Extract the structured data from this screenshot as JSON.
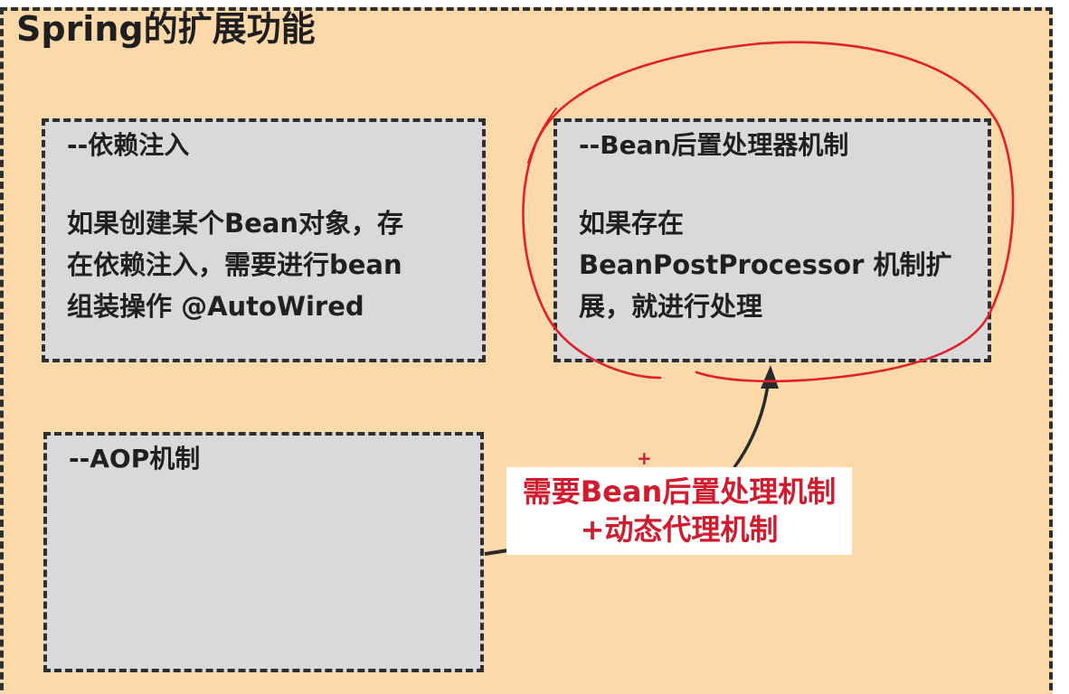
{
  "title": "Spring的扩展功能",
  "boxes": {
    "dependency_injection": {
      "title": "--依赖注入",
      "body_lines": [
        "如果创建某个Bean对象，存",
        "在依赖注入，需要进行bean",
        "组装操作 @AutoWired"
      ]
    },
    "bean_post_processor": {
      "title": "--Bean后置处理器机制",
      "body_lines": [
        "如果存在",
        "BeanPostProcessor 机制扩",
        "展，就进行处理"
      ]
    },
    "aop": {
      "title": "--AOP机制"
    }
  },
  "annotation": {
    "plus_mark": "+",
    "lines": [
      "需要Bean后置处理机制",
      "+动态代理机制"
    ]
  },
  "colors": {
    "background": "#fdd8a9",
    "box_fill": "#d9d9d9",
    "dashed_border": "#2f2f2f",
    "annotation_red": "#d01c2e",
    "circle_red": "#e0202a"
  }
}
